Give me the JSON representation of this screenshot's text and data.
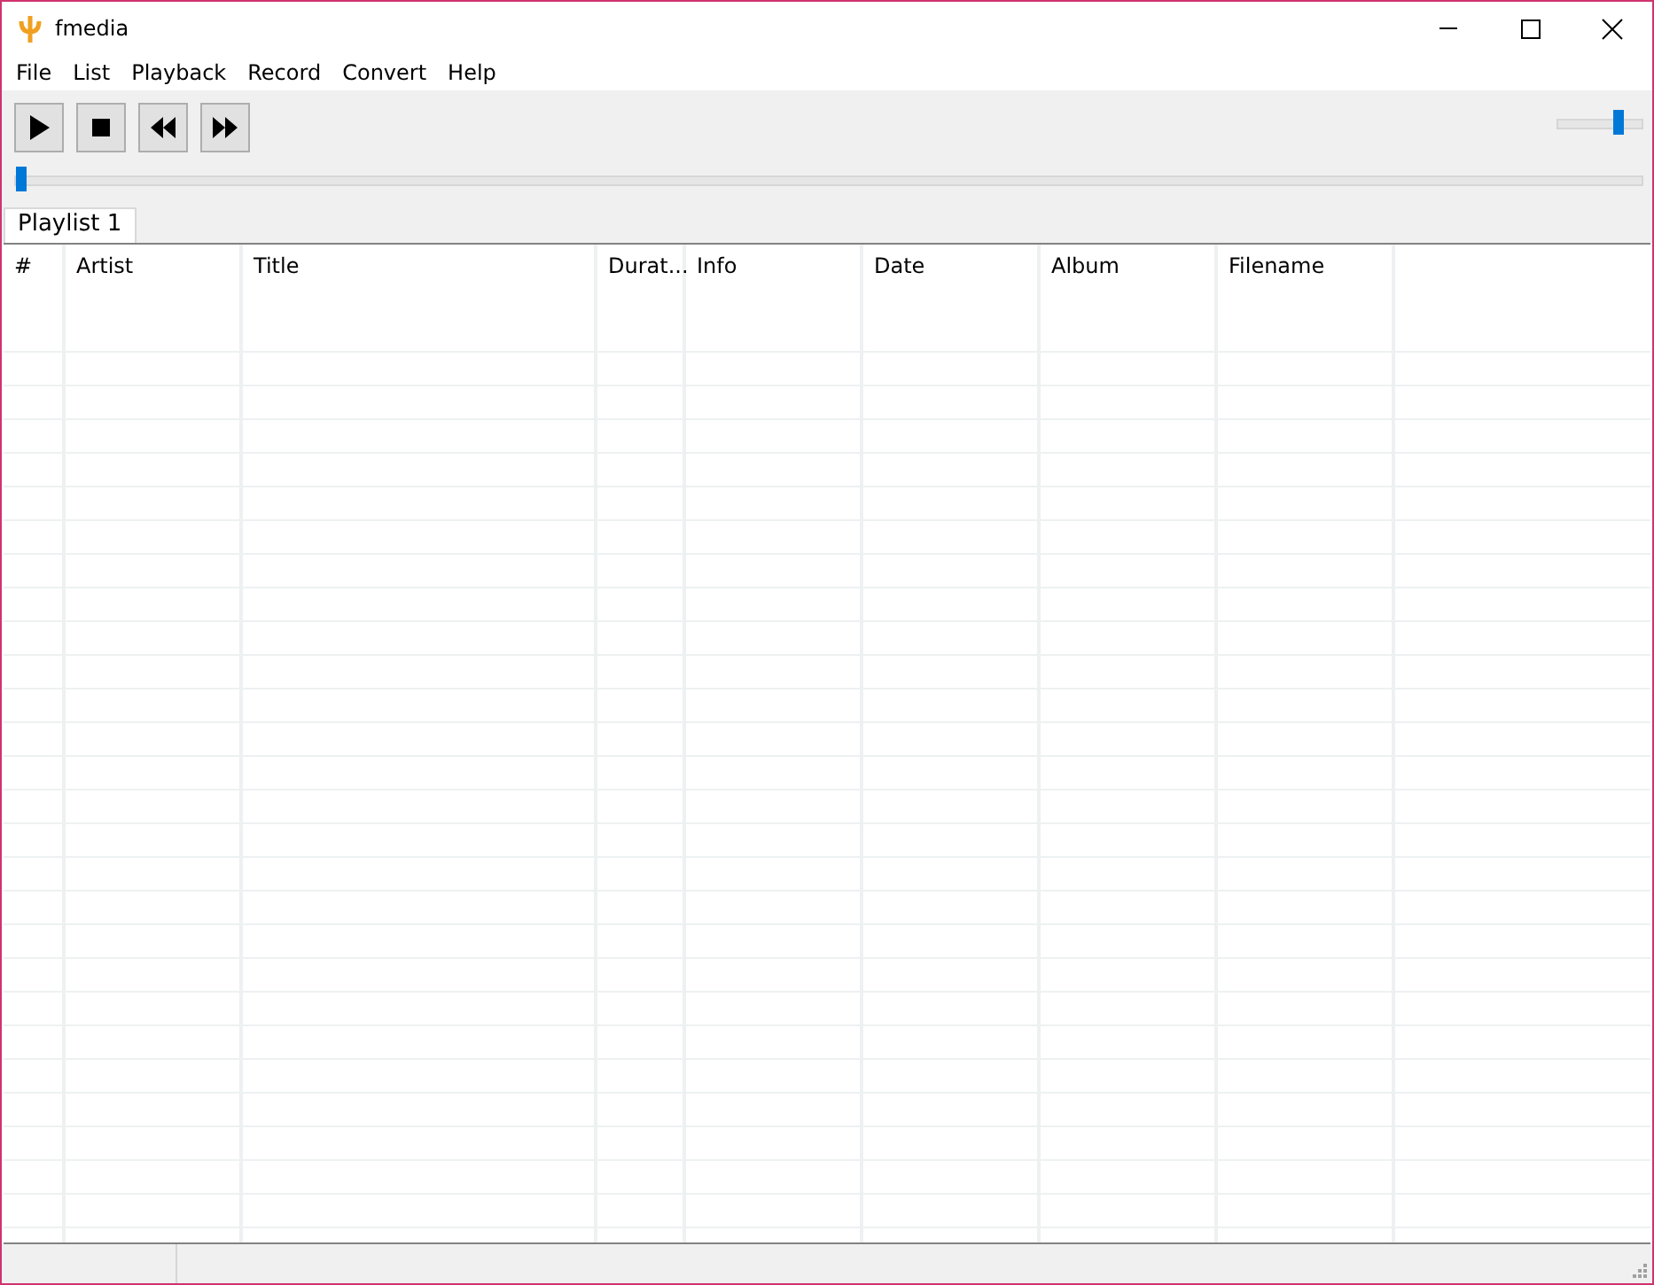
{
  "window": {
    "title": "fmedia"
  },
  "menu": [
    "File",
    "List",
    "Playback",
    "Record",
    "Convert",
    "Help"
  ],
  "toolbar": [
    {
      "kind": "play"
    },
    {
      "kind": "stop"
    },
    {
      "kind": "prev"
    },
    {
      "kind": "next"
    }
  ],
  "volume": {
    "level": 0.75
  },
  "seek": {
    "level": 0
  },
  "tabs": [
    {
      "label": "Playlist 1",
      "selected": true
    }
  ],
  "table": {
    "columns": [
      "#",
      "Artist",
      "Title",
      "Durat...",
      "Info",
      "Date",
      "Album",
      "Filename"
    ]
  }
}
